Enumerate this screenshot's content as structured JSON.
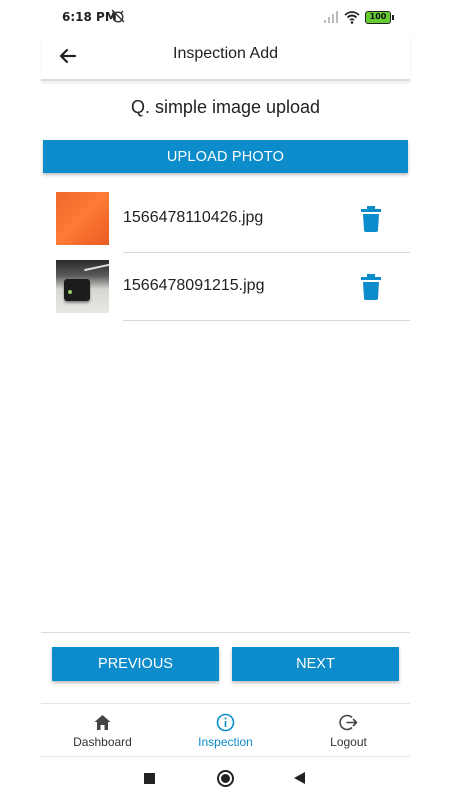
{
  "status_bar": {
    "time": "6:18 PM",
    "battery": "100",
    "icons": [
      "alarm-off-icon",
      "signal-icon",
      "wifi-icon",
      "battery-icon"
    ]
  },
  "app_bar": {
    "title": "Inspection Add",
    "back_icon": "arrow-left-icon"
  },
  "question": {
    "text": "Q. simple image upload"
  },
  "upload": {
    "label": "UPLOAD PHOTO"
  },
  "files": [
    {
      "name": "1566478110426.jpg",
      "thumb": "orange-photo",
      "delete_icon": "trash-icon"
    },
    {
      "name": "1566478091215.jpg",
      "thumb": "device-photo",
      "delete_icon": "trash-icon"
    }
  ],
  "actions": {
    "previous_label": "PREVIOUS",
    "next_label": "NEXT"
  },
  "bottom_nav": {
    "items": [
      {
        "label": "Dashboard",
        "icon": "home-icon",
        "active": false
      },
      {
        "label": "Inspection",
        "icon": "info-icon",
        "active": true
      },
      {
        "label": "Logout",
        "icon": "logout-icon",
        "active": false
      }
    ]
  },
  "colors": {
    "accent": "#0c8ccb",
    "battery": "#66cc33"
  }
}
